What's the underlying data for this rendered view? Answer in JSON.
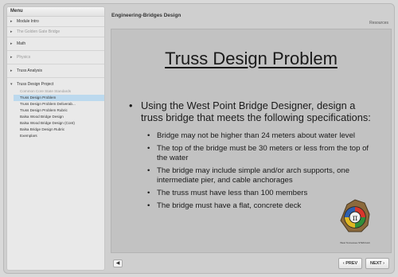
{
  "sidebar": {
    "header": "Menu",
    "items": [
      {
        "label": "Module Intro",
        "dim": false
      },
      {
        "label": "The Golden Gate Bridge",
        "dim": true
      },
      {
        "label": "Math",
        "dim": false
      },
      {
        "label": "Physics",
        "dim": true
      },
      {
        "label": "Truss Analysis",
        "dim": false
      }
    ],
    "project": {
      "label": "Truss Design Project",
      "subitems": [
        {
          "label": "Common Core State Standards",
          "state": "dim"
        },
        {
          "label": "Truss Design Problem",
          "state": "active"
        },
        {
          "label": "Truss Design Problem Deliverab...",
          "state": "normal"
        },
        {
          "label": "Truss Design Problem Rubric",
          "state": "normal"
        },
        {
          "label": "Balsa Wood Bridge Design",
          "state": "normal"
        },
        {
          "label": "Balsa Wood Bridge Design (Cont)",
          "state": "normal"
        },
        {
          "label": "Balsa Bridge Design Rubric",
          "state": "normal"
        },
        {
          "label": "Exemplars",
          "state": "normal"
        }
      ]
    }
  },
  "topbar": {
    "course_title": "Engineering-Bridges Design",
    "resources_label": "Resources"
  },
  "slide": {
    "title": "Truss Design Problem",
    "main_bullet": "Using the West Point Bridge Designer, design a truss bridge that meets the following specifications:",
    "sub_bullets": [
      "Bridge may not be higher than 24 meters about water level",
      "The top of the bridge must be 30 meters or less from the top of the water",
      "The bridge may include simple and/or arch supports, one intermediate pier, and cable anchorages",
      "The truss must have less than 100 members",
      "The bridge must have a flat, concrete deck"
    ],
    "logo_caption": "West Tennessee STEM Hub",
    "logo_symbol": "π"
  },
  "controls": {
    "volume_icon": "speaker-icon",
    "prev_label": "‹ PREV",
    "next_label": "NEXT ›"
  },
  "colors": {
    "active_item": "#bcd9ee",
    "slide_bg": "#c2c2c2"
  }
}
